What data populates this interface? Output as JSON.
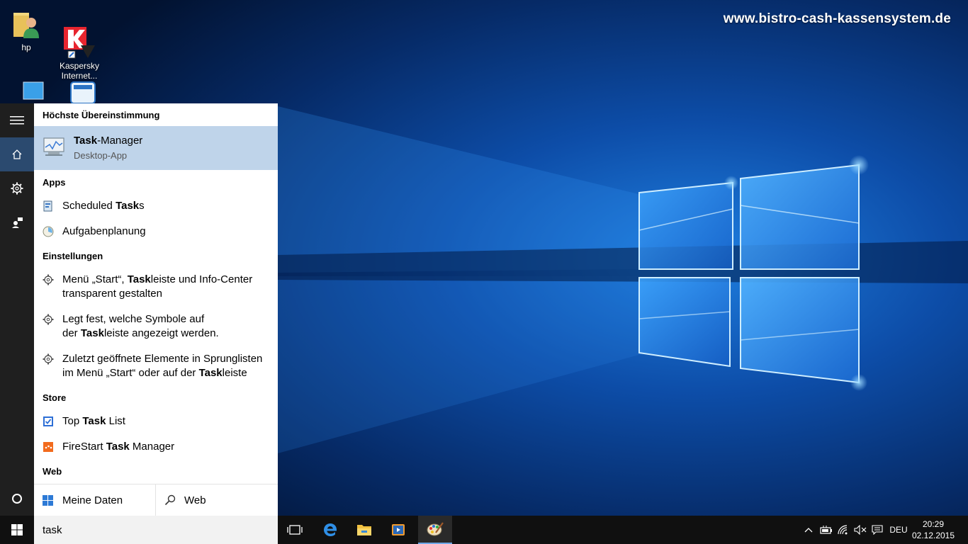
{
  "desktop": {
    "watermark": "www.bistro-cash-kassensystem.de",
    "icons": [
      {
        "label": "hp"
      },
      {
        "label": "Kaspersky\nInternet..."
      }
    ]
  },
  "start_menu": {
    "best_match_header": "Höchste Übereinstimmung",
    "best_match": {
      "title_pre": "Task",
      "title_post": "-Manager",
      "subtitle": "Desktop-App"
    },
    "apps_header": "Apps",
    "apps": [
      {
        "pre": "Scheduled ",
        "bold": "Task",
        "post": "s"
      },
      {
        "pre": "Aufgabenplanung",
        "bold": "",
        "post": ""
      }
    ],
    "settings_header": "Einstellungen",
    "settings": [
      {
        "line1_pre": "Menü „Start“, ",
        "line1_bold": "Task",
        "line1_post": "leiste und Info-Center",
        "line2_pre": "transparent gestalten",
        "line2_bold": "",
        "line2_post": ""
      },
      {
        "line1_pre": "Legt fest, welche Symbole auf",
        "line1_bold": "",
        "line1_post": "",
        "line2_pre": "der ",
        "line2_bold": "Task",
        "line2_post": "leiste angezeigt werden."
      },
      {
        "line1_pre": "Zuletzt geöffnete Elemente in Sprunglisten",
        "line1_bold": "",
        "line1_post": "",
        "line2_pre": "im Menü „Start“ oder auf der ",
        "line2_bold": "Task",
        "line2_post": "leiste"
      }
    ],
    "store_header": "Store",
    "store": [
      {
        "pre": "Top ",
        "bold": "Task",
        "post": " List"
      },
      {
        "pre": "FireStart ",
        "bold": "Task",
        "post": " Manager"
      }
    ],
    "web_header": "Web",
    "bottom": {
      "my_data": "Meine Daten",
      "web": "Web"
    }
  },
  "taskbar": {
    "search_value": "task",
    "language": "DEU",
    "time": "20:29",
    "date": "02.12.2015"
  },
  "colors": {
    "accent": "#2b4a6f",
    "selection": "#bfd4ea",
    "taskbar": "#101010"
  }
}
